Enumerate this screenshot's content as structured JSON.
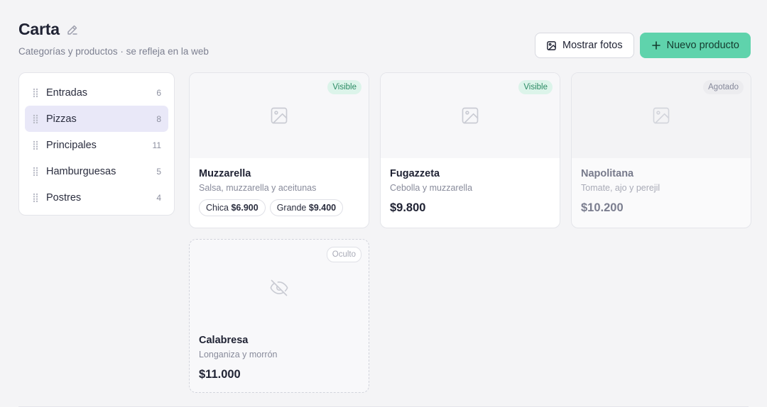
{
  "header": {
    "title": "Carta",
    "subtitle": "Categorías y productos · se refleja en la web"
  },
  "actions": {
    "show_photos_label": "Mostrar fotos",
    "new_product_label": "Nuevo producto"
  },
  "categories": [
    {
      "label": "Entradas",
      "count": "6"
    },
    {
      "label": "Pizzas",
      "count": "8",
      "active": true
    },
    {
      "label": "Principales",
      "count": "11"
    },
    {
      "label": "Hamburguesas",
      "count": "5"
    },
    {
      "label": "Postres",
      "count": "4"
    }
  ],
  "products": [
    {
      "name": "Muzzarella",
      "description": "Salsa, muzzarella y aceitunas",
      "status": "Visible",
      "variants": [
        {
          "size": "Chica",
          "price": "$6.900"
        },
        {
          "size": "Grande",
          "price": "$9.400"
        }
      ]
    },
    {
      "name": "Fugazzeta",
      "description": "Cebolla y muzzarella",
      "status": "Visible",
      "price": "$9.800"
    },
    {
      "name": "Napolitana",
      "description": "Tomate, ajo y perejil",
      "status": "Agotado",
      "price": "$10.200"
    },
    {
      "name": "Calabresa",
      "description": "Longaniza y morrón",
      "status": "Oculto",
      "price": "$11.000"
    }
  ],
  "colors": {
    "accent": "#5fd3ac",
    "active_category_bg": "#e9e8f8",
    "visible_badge": "#dcf4ea",
    "agotado_badge": "#ececef"
  }
}
